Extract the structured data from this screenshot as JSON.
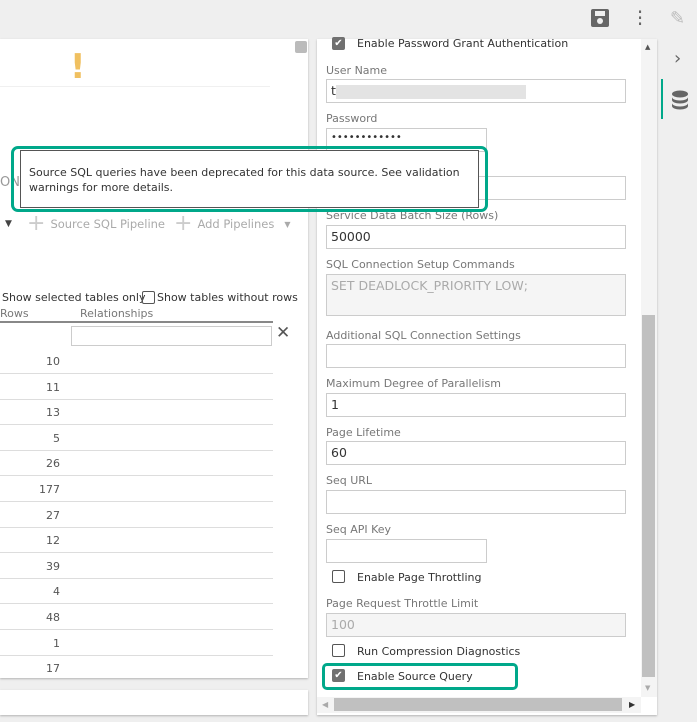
{
  "toolbar": {
    "icons": [
      "save-icon",
      "more-vertical-icon",
      "pencil-icon",
      "chevron-right-icon",
      "database-icon"
    ]
  },
  "accent": "#00a88a",
  "left": {
    "warning_icon": "!",
    "partial_text": "ON",
    "source_sql_pipeline": "Source SQL Pipeline",
    "add_pipelines": "Add Pipelines",
    "show_selected": "Show selected tables only",
    "show_without_rows": "Show tables without rows",
    "columns": [
      "Rows",
      "Relationships"
    ],
    "rows": [
      "10",
      "11",
      "13",
      "5",
      "26",
      "177",
      "27",
      "12",
      "39",
      "4",
      "48",
      "1",
      "17"
    ]
  },
  "tooltip": {
    "text": "Source SQL queries have been deprecated for this data source. See validation warnings for more details."
  },
  "form": {
    "enable_password_grant": {
      "label": "Enable Password Grant Authentication",
      "checked": true
    },
    "user_name": {
      "label": "User Name",
      "value": "t"
    },
    "password": {
      "label": "Password",
      "value": "••••••••••••"
    },
    "batch_size": {
      "label": "Service Data Batch Size (Rows)",
      "value": "50000"
    },
    "setup_commands": {
      "label": "SQL Connection Setup Commands",
      "value": "SET DEADLOCK_PRIORITY LOW;"
    },
    "additional_settings": {
      "label": "Additional SQL Connection Settings",
      "value": ""
    },
    "parallelism": {
      "label": "Maximum Degree of Parallelism",
      "value": "1"
    },
    "page_lifetime": {
      "label": "Page Lifetime",
      "value": "60"
    },
    "seq_url": {
      "label": "Seq URL",
      "value": ""
    },
    "seq_api_key": {
      "label": "Seq API Key",
      "value": ""
    },
    "page_throttling": {
      "label": "Enable Page Throttling",
      "checked": false
    },
    "throttle_limit": {
      "label": "Page Request Throttle Limit",
      "value": "100"
    },
    "compression_diag": {
      "label": "Run Compression Diagnostics",
      "checked": false
    },
    "source_query": {
      "label": "Enable Source Query",
      "checked": true
    }
  }
}
